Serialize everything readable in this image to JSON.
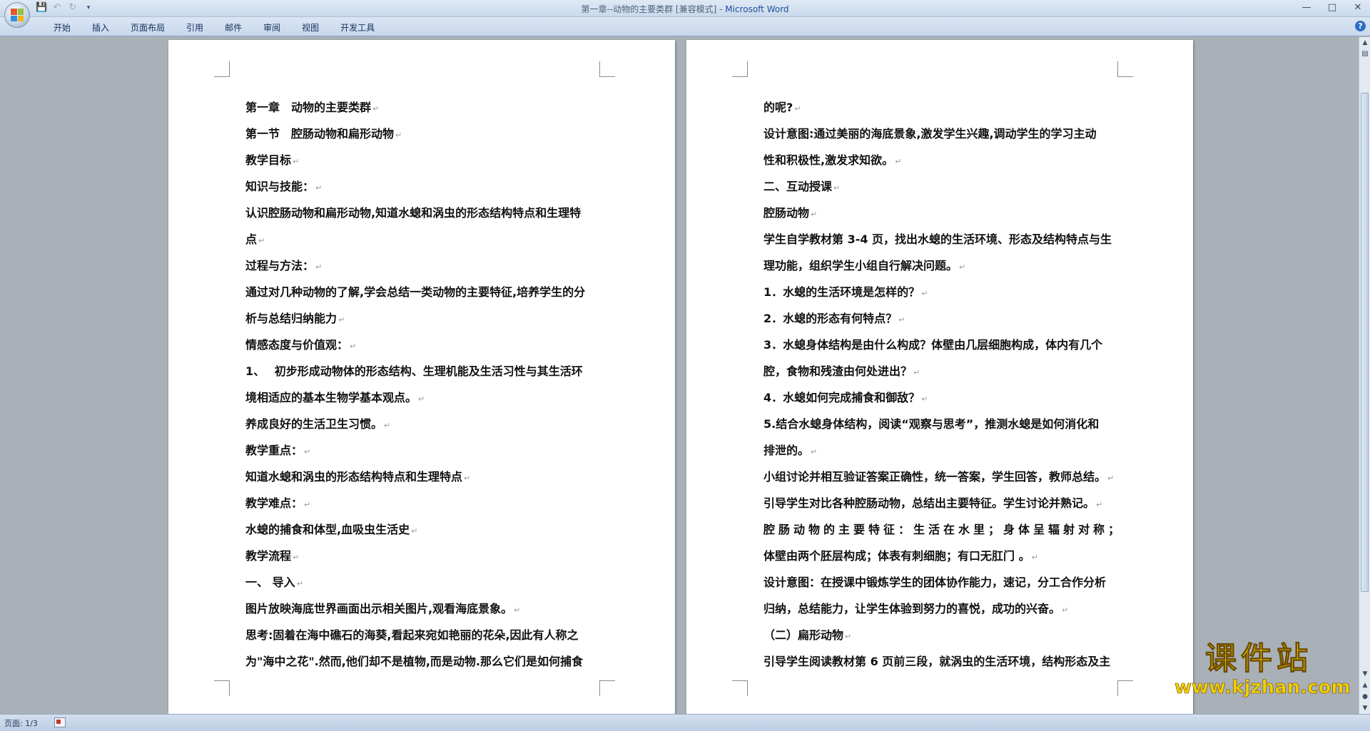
{
  "window": {
    "title": "第一章--动物的主要类群 [兼容模式] - ",
    "app_name": "Microsoft Word"
  },
  "ribbon": {
    "tabs": [
      "开始",
      "插入",
      "页面布局",
      "引用",
      "邮件",
      "审阅",
      "视图",
      "开发工具"
    ]
  },
  "document": {
    "left_page_lines": [
      "第一章　动物的主要类群",
      "第一节　腔肠动物和扁形动物",
      "教学目标",
      "知识与技能：",
      "认识腔肠动物和扁形动物,知道水螅和涡虫的形态结构特点和生理特",
      "点",
      "过程与方法：",
      "通过对几种动物的了解,学会总结一类动物的主要特征,培养学生的分",
      "析与总结归纳能力",
      "情感态度与价值观：",
      "1、　 初步形成动物体的形态结构、生理机能及生活习性与其生活环",
      "境相适应的基本生物学基本观点。",
      "养成良好的生活卫生习惯。",
      "教学重点：",
      "知道水螅和涡虫的形态结构特点和生理特点",
      "教学难点：",
      "水螅的捕食和体型,血吸虫生活史",
      "教学流程",
      "一、 导入",
      "图片放映海底世界画面出示相关图片,观看海底景象。",
      "思考:固着在海中礁石的海葵,看起来宛如艳丽的花朵,因此有人称之",
      "为\"海中之花\".然而,他们却不是植物,而是动物.那么它们是如何捕食"
    ],
    "right_page_lines": [
      "的呢?",
      "设计意图:通过美丽的海底景象,激发学生兴趣,调动学生的学习主动",
      "性和积极性,激发求知欲。",
      "二、互动授课",
      "腔肠动物",
      "学生自学教材第 3-4 页，找出水螅的生活环境、形态及结构特点与生",
      "理功能，组织学生小组自行解决问题。",
      "1．水螅的生活环境是怎样的？",
      "2．水螅的形态有何特点？",
      "3．水螅身体结构是由什么构成？体壁由几层细胞构成，体内有几个",
      "腔，食物和残渣由何处进出？",
      "4．水螅如何完成捕食和御敌？",
      "5.结合水螅身体结构，阅读“观察与思考”，推测水螅是如何消化和",
      "排泄的。",
      "小组讨论并相互验证答案正确性，统一答案，学生回答，教师总结。",
      "引导学生对比各种腔肠动物，总结出主要特征。学生讨论并熟记。",
      "腔肠动物的主要特征：生活在水里；身体呈辐射对称；",
      "体壁由两个胚层构成；体表有刺细胞；有口无肛门 。",
      "设计意图：在授课中锻炼学生的团体协作能力，速记，分工合作分析",
      "归纳，总结能力，让学生体验到努力的喜悦，成功的兴奋。",
      "（二）扁形动物",
      "引导学生阅读教材第 6 页前三段，就涡虫的生活环境，结构形态及主"
    ],
    "paragraph_mark": "↵"
  },
  "statusbar": {
    "page_info": "页面: 1/3"
  },
  "watermark": {
    "title": "课件站",
    "url": "www.kjzhan.com"
  },
  "icons": {
    "office_button": "office-logo-icon",
    "save": "save-icon",
    "undo": "undo-icon",
    "redo": "redo-icon",
    "customize": "dropdown-icon",
    "minimize": "minimize-icon",
    "maximize": "maximize-icon",
    "close": "close-icon",
    "help": "help-icon"
  }
}
